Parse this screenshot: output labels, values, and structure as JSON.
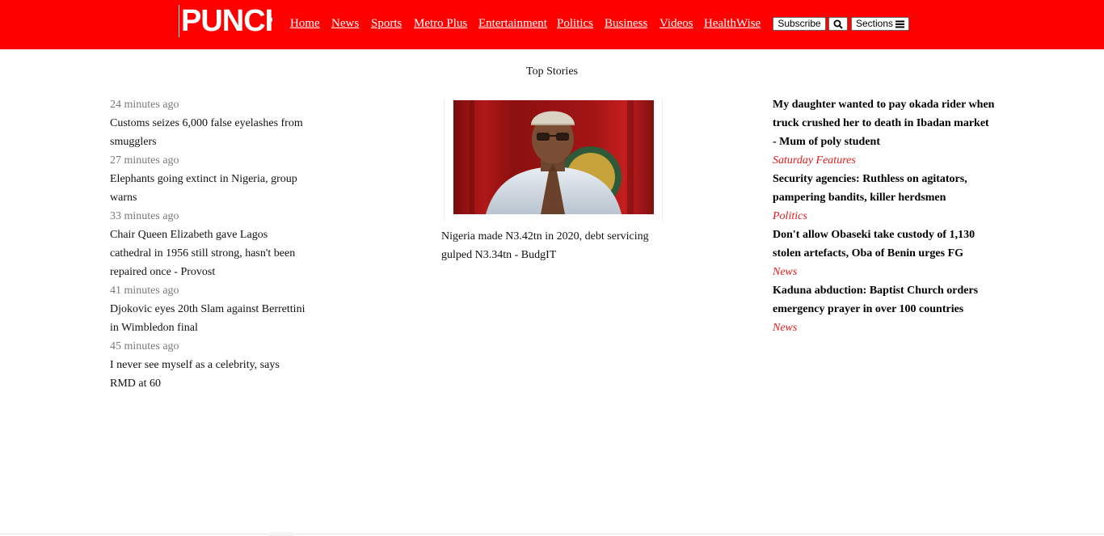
{
  "header": {
    "logo_text": "PUNCH",
    "nav": [
      "Home",
      "News",
      "Sports",
      "Metro Plus",
      "Entertainment",
      "Politics",
      "Business",
      "Videos",
      "HealthWise"
    ],
    "subscribe_label": "Subscribe",
    "sections_label": "Sections"
  },
  "section_title": "Top Stories",
  "latest": [
    {
      "time": "24 minutes ago",
      "title": "Customs seizes 6,000 false eyelashes from smugglers"
    },
    {
      "time": "27 minutes ago",
      "title": "Elephants going extinct in Nigeria, group warns"
    },
    {
      "time": "33 minutes ago",
      "title": "Chair Queen Elizabeth gave Lagos cathedral in 1956 still strong, hasn't been repaired once - Provost"
    },
    {
      "time": "41 minutes ago",
      "title": "Djokovic eyes 20th Slam against Berrettini in Wimbledon final"
    },
    {
      "time": "45 minutes ago",
      "title": "I never see myself as a celebrity, says RMD at 60"
    }
  ],
  "featured": {
    "title": "Nigeria made N3.42tn in 2020, debt servicing gulped N3.34tn - BudgIT"
  },
  "right_stories": [
    {
      "title": "My daughter wanted to pay okada rider when truck crushed her to death in Ibadan market - Mum of poly student",
      "category": "Saturday Features"
    },
    {
      "title": "Security agencies: Ruthless on agitators, pampering bandits, killer herdsmen",
      "category": "Politics"
    },
    {
      "title": "Don't allow Obaseki take custody of 1,130 stolen artefacts, Oba of Benin urges FG",
      "category": "News"
    },
    {
      "title": "Kaduna abduction: Baptist Church orders emergency prayer in over 100 countries",
      "category": "News"
    }
  ],
  "colors": {
    "brand_red": "#ff0000",
    "category_red": "#e31b1b",
    "timestamp_gray": "#7a7a7a"
  },
  "icons": {
    "search": "search-icon",
    "sections": "hamburger-menu-icon"
  }
}
